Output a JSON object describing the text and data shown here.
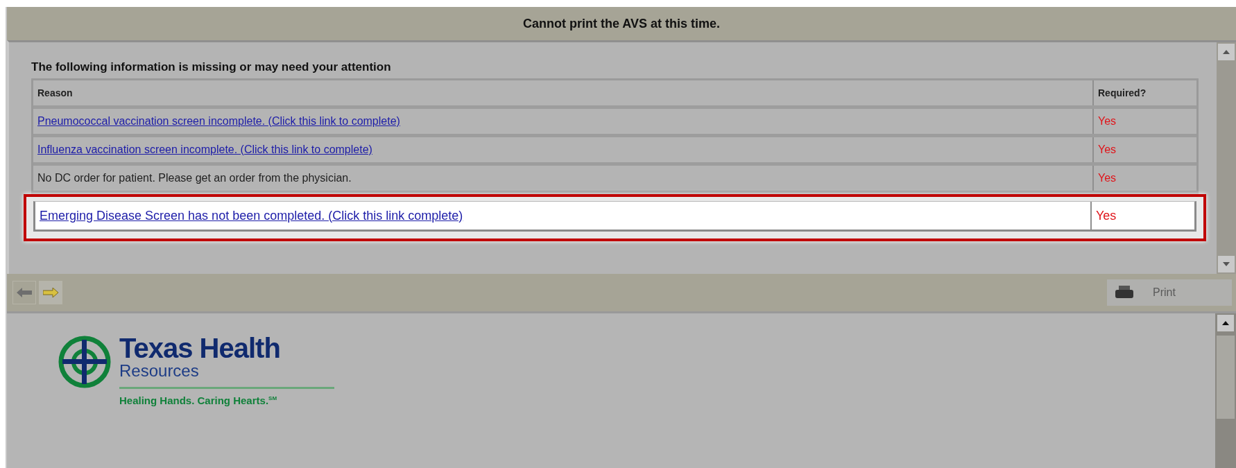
{
  "window": {
    "title": "Cannot print the AVS at this time."
  },
  "issues": {
    "heading": "The following information is missing or may need your attention",
    "columns": [
      "Reason",
      "Required?"
    ],
    "rows": [
      {
        "kind": "link",
        "reason": "Pneumococcal vaccination screen incomplete. (Click this link to complete)",
        "required": "Yes",
        "highlighted": false
      },
      {
        "kind": "link",
        "reason": "Influenza vaccination screen incomplete. (Click this link to complete)",
        "required": "Yes",
        "highlighted": false
      },
      {
        "kind": "text",
        "reason": "No DC order for patient. Please get an order from the physician.",
        "required": "Yes",
        "highlighted": false
      },
      {
        "kind": "link",
        "reason": "Emerging Disease Screen has not been completed. (Click this link complete)",
        "required": "Yes",
        "highlighted": true
      }
    ]
  },
  "toolbar": {
    "back": {
      "disabled": true
    },
    "forward": {
      "disabled": false
    },
    "print": {
      "label": "Print",
      "disabled": true
    }
  },
  "document": {
    "logo": {
      "name": "Texas Health",
      "subname": "Resources",
      "tagline": "Healing Hands. Caring Hearts.$^{SM}$"
    }
  }
}
